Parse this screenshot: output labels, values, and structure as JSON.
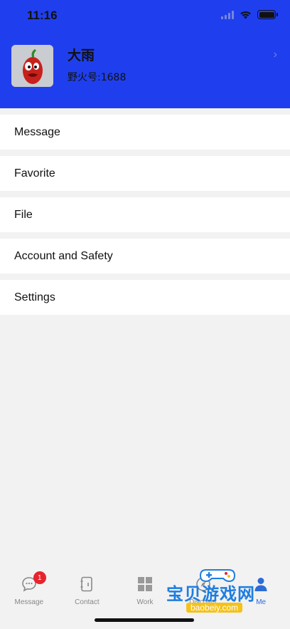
{
  "status_bar": {
    "time": "11:16"
  },
  "profile": {
    "name": "大雨",
    "id_label": "野火号:1688"
  },
  "menu": {
    "items": [
      {
        "label": "Message"
      },
      {
        "label": "Favorite"
      },
      {
        "label": "File"
      },
      {
        "label": "Account and Safety"
      },
      {
        "label": "Settings"
      }
    ]
  },
  "tabbar": {
    "tabs": [
      {
        "label": "Message",
        "badge": "1",
        "icon": "chat-bubble-icon"
      },
      {
        "label": "Contact",
        "icon": "contact-book-icon"
      },
      {
        "label": "Work",
        "icon": "grid-icon"
      },
      {
        "label": "Discover",
        "icon": "compass-icon"
      },
      {
        "label": "Me",
        "icon": "person-icon"
      }
    ]
  },
  "watermark": {
    "main": "宝贝游戏网",
    "sub": "baobeiy.com"
  },
  "colors": {
    "header": "#1f3fee",
    "badge": "#e8232d",
    "background": "#f2f2f2"
  }
}
